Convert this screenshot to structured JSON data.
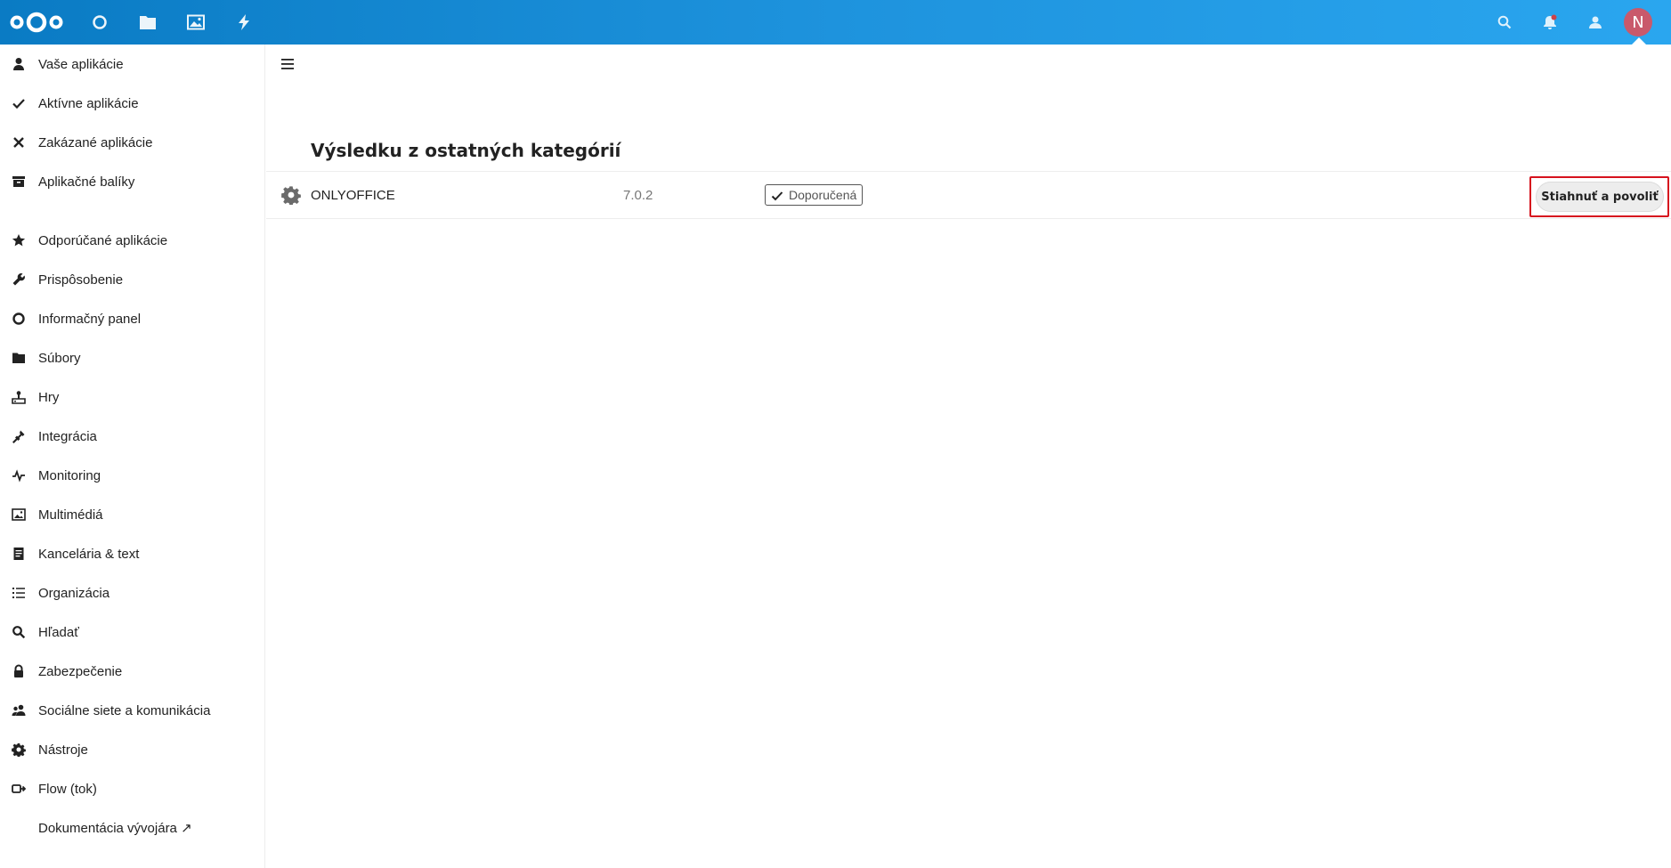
{
  "header": {
    "apps": [
      {
        "name": "dashboard",
        "icon": "circle-icon"
      },
      {
        "name": "files",
        "icon": "folder-icon"
      },
      {
        "name": "photos",
        "icon": "image-icon"
      },
      {
        "name": "activity",
        "icon": "lightning-icon"
      }
    ],
    "right_icons": [
      "search-icon",
      "notifications-icon",
      "contacts-icon"
    ],
    "avatar_initial": "N",
    "notification_dot_color": "#e9322d"
  },
  "sidebar": {
    "items": [
      {
        "label": "Vaše aplikácie",
        "icon": "user-icon"
      },
      {
        "label": "Aktívne aplikácie",
        "icon": "checkmark-icon"
      },
      {
        "label": "Zakázané aplikácie",
        "icon": "close-icon"
      },
      {
        "label": "Aplikačné balíky",
        "icon": "archive-icon"
      },
      {
        "label": "Odporúčané aplikácie",
        "icon": "star-icon"
      },
      {
        "label": "Prispôsobenie",
        "icon": "wrench-icon"
      },
      {
        "label": "Informačný panel",
        "icon": "circle-icon"
      },
      {
        "label": "Súbory",
        "icon": "folder-icon"
      },
      {
        "label": "Hry",
        "icon": "joystick-icon"
      },
      {
        "label": "Integrácia",
        "icon": "plug-icon"
      },
      {
        "label": "Monitoring",
        "icon": "pulse-icon"
      },
      {
        "label": "Multimédiá",
        "icon": "image-icon"
      },
      {
        "label": "Kancelária & text",
        "icon": "document-icon"
      },
      {
        "label": "Organizácia",
        "icon": "list-icon"
      },
      {
        "label": "Hľadať",
        "icon": "search-icon"
      },
      {
        "label": "Zabezpečenie",
        "icon": "lock-icon"
      },
      {
        "label": "Sociálne siete a komunikácia",
        "icon": "people-icon"
      },
      {
        "label": "Nástroje",
        "icon": "gear-icon"
      },
      {
        "label": "Flow (tok)",
        "icon": "flow-icon"
      },
      {
        "label": "Dokumentácia vývojára ↗",
        "icon": ""
      }
    ]
  },
  "main": {
    "section_title": "Výsledku z ostatných kategórií",
    "apps": [
      {
        "name": "ONLYOFFICE",
        "version": "7.0.2",
        "badge": "Doporučená",
        "action_label": "Stiahnuť a povoliť"
      }
    ]
  },
  "colors": {
    "header_gradient_start": "#0a7bc4",
    "header_gradient_end": "#2aa6ef",
    "highlight": "#d6121e",
    "avatar_bg": "#c9596b"
  }
}
